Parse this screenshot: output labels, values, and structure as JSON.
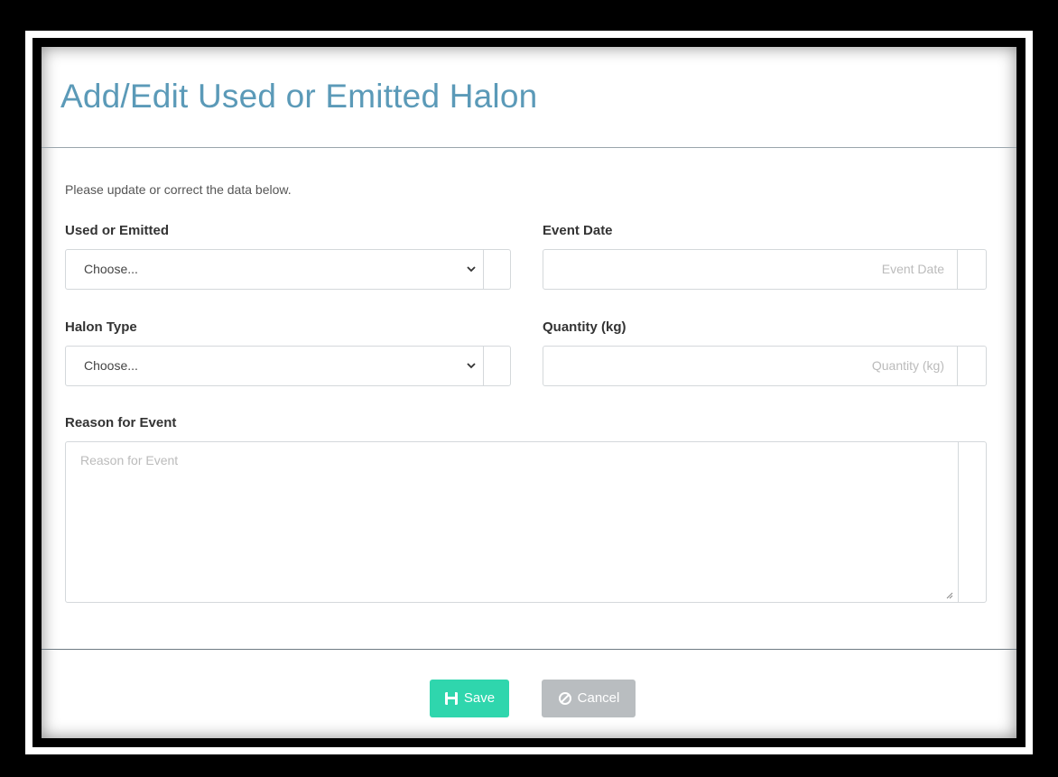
{
  "modal": {
    "title": "Add/Edit Used or Emitted Halon",
    "intro": "Please update or correct the data below."
  },
  "fields": {
    "used_or_emitted": {
      "label": "Used or Emitted",
      "value": "Choose..."
    },
    "event_date": {
      "label": "Event Date",
      "placeholder": "Event Date"
    },
    "halon_type": {
      "label": "Halon Type",
      "value": "Choose..."
    },
    "quantity": {
      "label": "Quantity (kg)",
      "placeholder": "Quantity (kg)"
    },
    "reason": {
      "label": "Reason for Event",
      "placeholder": "Reason for Event"
    }
  },
  "footer": {
    "save_label": "Save",
    "save_icon": "floppy-disk-icon",
    "cancel_label": "Cancel",
    "cancel_icon": "ban-icon"
  },
  "colors": {
    "title": "#5b9ab8",
    "save": "#2fd6ad",
    "cancel": "#b9bdc0"
  }
}
